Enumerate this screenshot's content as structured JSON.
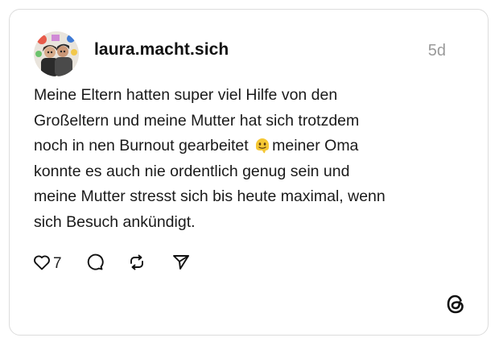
{
  "post": {
    "username": "laura.macht.sich",
    "timestamp": "5d",
    "text_lines": [
      "Meine Eltern hatten super viel Hilfe von den",
      "Großeltern und meine Mutter hat sich trotzdem",
      "noch in nen Burnout gearbeitet",
      "meiner Oma",
      "konnte es auch nie ordentlich genug sein und",
      "meine Mutter stresst sich bis heute maximal, wenn",
      "sich Besuch ankündigt."
    ],
    "inline_emoji": "melting-face-emoji"
  },
  "actions": {
    "like_count": "7",
    "icons": [
      "heart-icon",
      "comment-icon",
      "repost-icon",
      "share-icon"
    ]
  },
  "brand": {
    "logo": "threads-logo-icon"
  }
}
